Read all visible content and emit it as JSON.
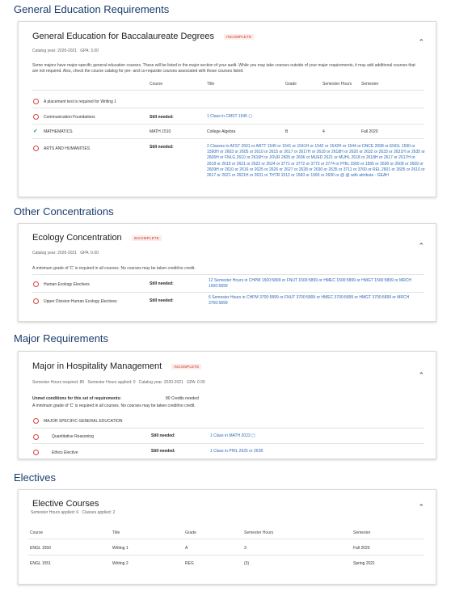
{
  "gened": {
    "section_title": "General Education Requirements",
    "title": "General Education for Baccalaureate Degrees",
    "badge": "INCOMPLETE",
    "catalog": "Catalog year:  2020-2021",
    "gpa": "GPA:  3.00",
    "para": "Some majors have major-specific general education courses. These will be listed in the major section of your audit. While you may take courses outside of your major requirements, it may add additional courses that are not required. Also, check the course catalog for pre- and co-requisite courses associated with those courses listed.",
    "columns": [
      "Course",
      "Title",
      "Grade",
      "Semester Hours",
      "Semester"
    ],
    "rows": [
      {
        "label": "A placement test is required for Writing 1"
      },
      {
        "label": "Communication Foundations",
        "status": "Still needed:",
        "req": "1 Class in CMST 1545"
      },
      {
        "label": "MATHEMATICS",
        "course": "MATH 1510",
        "title": "College Algebra",
        "grade": "B",
        "hours": "4",
        "semester": "Fall 2020"
      },
      {
        "label": "ARTS AND HUMANITIES",
        "status": "Still needed:",
        "req": "2 Classes in AFST 2601 or ARTT 1540 or 1541 or 1541H or 1542 or 1542H or 1544 or DNCE 2698 or ENGL 1590 or 1590H or 2603 or 2605 or 2610 or 2615 or 2617 or 2617H or 2618 or 2618H or 2620 or 2632 or 2633 or 2631H or 2635 or 2665H or FNLG 2610 or 2610H or JOUR 2605 or 2606 or MUED 2621 or MUHL 2618 or 2618H or 2617 or 2617H or 2618 or 2619 or 2621 or 2622 or 2624 or 3771 or 3772 or 3773 or 3774 or PHIL 1560 or 1565 or 2600 or 2608 or 2609 or 2609H or 2610 or 2616 or 2625 or 2626 or 2627 or 2628 or 2630 or 2635 or 3711 or 3760 or REL 2601 or 2605 or 2610 or 2617 or 2621 or 2621H or 2631 or THTR 1512 or 1560 or 1560 or 2690 or @ @ with attribute - GEAH"
      }
    ]
  },
  "other": {
    "section_title": "Other Concentrations",
    "title": "Ecology Concentration",
    "badge": "INCOMPLETE",
    "catalog": "Catalog year:  2020-2021",
    "gpa": "GPA:  0.00",
    "note": "A minimum grade of 'C' is required in all courses. No courses may be taken credit/no credit.",
    "rows": [
      {
        "label": "Human Ecology Electives",
        "status": "Still needed:",
        "req": "12 Semester Hours in CHPM 1500:5899 or FNUT 1500:5899 or HMEC 1500:5899 or HMGT 1500:5899 or MRCH 1500:5899"
      },
      {
        "label": "Upper Division Human Ecology Electives",
        "status": "Still needed:",
        "req": "6 Semester Hours in CHPM 3700:5899 or FNUT 3700:5899 or HMEC 3700:5899 or HMGT 3700:5899 or MRCH 3700:5899"
      }
    ]
  },
  "major": {
    "section_title": "Major Requirements",
    "title": "Major in Hospitality Management",
    "badge": "INCOMPLETE",
    "hours_required": "Semester Hours required:  80",
    "hours_applied": "Semester Hours applied:  0",
    "catalog": "Catalog year:  2020-2021",
    "gpa": "GPA:  0.00",
    "unmet_label": "Unmet conditions for this set of requirements:",
    "unmet_value": "80 Credits needed",
    "note": "A minimum grade of 'C' is required in all courses. No courses may be taken credit/no credit.",
    "rows": [
      {
        "label": "MAJOR SPECIFIC GENERAL EDUCATION"
      },
      {
        "label": "Quantitative Reasoning",
        "status": "Still needed:",
        "req": "1 Class in MATH 2023"
      },
      {
        "label": "Ethics Elective",
        "status": "Still needed:",
        "req": "1 Class in PHIL 2625 or 2628"
      }
    ]
  },
  "electives": {
    "section_title": "Electives",
    "title": "Elective Courses",
    "hours_applied": "Semester Hours applied:  6",
    "classes_applied": "Classes applied:  2",
    "columns": [
      "Course",
      "Title",
      "Grade",
      "Semester Hours",
      "Semester"
    ],
    "rows": [
      {
        "course": "ENGL 1550",
        "title": "Writing 1",
        "grade": "A",
        "hours": "3",
        "semester": "Fall 2020"
      },
      {
        "course": "ENGL 1551",
        "title": "Writing 2",
        "grade": "REG",
        "hours": "(3)",
        "semester": "Spring 2021"
      }
    ]
  },
  "icons": {
    "chevron": "chevron-up-icon",
    "incomplete": "circle-outline-icon",
    "complete": "check-circle-icon"
  },
  "colors": {
    "section_title": "#1a3c6e",
    "badge": "#c0392b",
    "link": "#2d6ab8",
    "incomplete": "#d64541",
    "complete": "#27ae60"
  }
}
